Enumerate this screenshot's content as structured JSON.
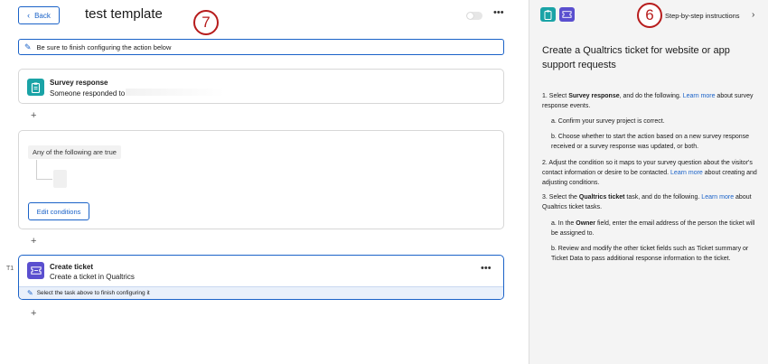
{
  "header": {
    "back_label": "Back",
    "title": "test template",
    "callout_left": "7",
    "callout_right": "6"
  },
  "banner": {
    "text": "Be sure to finish configuring the action below"
  },
  "survey_card": {
    "title": "Survey response",
    "subtitle": "Someone responded to"
  },
  "condition_card": {
    "chip": "Any of the following are true",
    "edit_label": "Edit conditions"
  },
  "ticket_card": {
    "step": "T1",
    "title": "Create ticket",
    "subtitle": "Create a ticket in Qualtrics",
    "footer": "Select the task above to finish configuring it"
  },
  "more_glyph": "•••",
  "plus_glyph": "+",
  "panel": {
    "steps_label": "Step-by-step instructions",
    "heading": "Create a Qualtrics ticket for website or app support requests",
    "step1": {
      "num": "1.",
      "pre": "Select ",
      "bold": "Survey response",
      "mid": ", and do the following. ",
      "link": "Learn more",
      "post": " about survey response events."
    },
    "step1a": "a. Confirm your survey project is correct.",
    "step1b": "b. Choose whether to start the action based on a new survey response received or a survey response was updated, or both.",
    "step2": {
      "num": "2.",
      "pre": "Adjust the condition so it maps to your survey question about the visitor's contact information or desire to be contacted. ",
      "link": "Learn more",
      "post": " about creating and adjusting conditions."
    },
    "step3": {
      "num": "3.",
      "pre": "Select the ",
      "bold": "Qualtrics ticket",
      "mid": " task, and do the following. ",
      "link": "Learn more",
      "post": " about Qualtrics ticket tasks."
    },
    "step3a": {
      "pre": "a. In the ",
      "bold": "Owner",
      "post": " field, enter the email address of the person the ticket will be assigned to."
    },
    "step3b": "b. Review and modify the other ticket fields such as Ticket summary or Ticket Data to pass additional response information to the ticket."
  },
  "colors": {
    "accent": "#1a62c8",
    "callout": "#b71c1c",
    "survey_tile": "#1aa3a6",
    "ticket_tile": "#5a4fcf",
    "panel_bg": "#f4f4f4"
  },
  "icons": {
    "back": "chevron-left-icon",
    "banner": "pencil-icon",
    "survey": "clipboard-icon",
    "ticket": "ticket-icon",
    "steps": "chevron-right-icon"
  }
}
